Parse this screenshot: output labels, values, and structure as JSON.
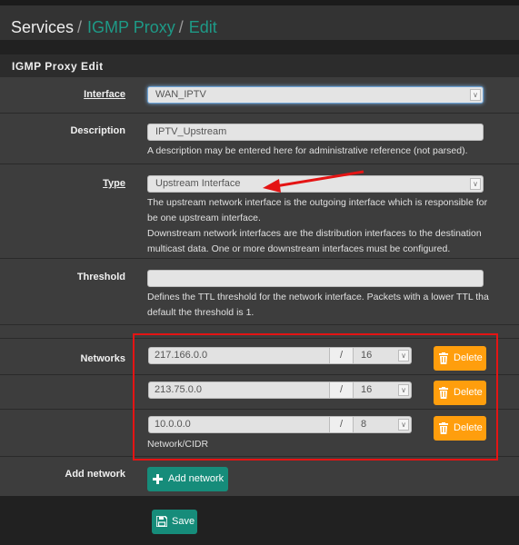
{
  "breadcrumb": {
    "root": "Services",
    "items": [
      "IGMP Proxy",
      "Edit"
    ],
    "separator": "/"
  },
  "panel": {
    "title": "IGMP Proxy Edit"
  },
  "form": {
    "interface": {
      "label": "Interface",
      "value": "WAN_IPTV"
    },
    "description": {
      "label": "Description",
      "value": "IPTV_Upstream",
      "help": "A description may be entered here for administrative reference (not parsed)."
    },
    "type": {
      "label": "Type",
      "value": "Upstream Interface",
      "help": [
        "The upstream network interface is the outgoing interface which is responsible for",
        "be one upstream interface.",
        "Downstream network interfaces are the distribution interfaces to the destination",
        "multicast data. One or more downstream interfaces must be configured."
      ]
    },
    "threshold": {
      "label": "Threshold",
      "value": "",
      "help": [
        "Defines the TTL threshold for the network interface. Packets with a lower TTL tha",
        "default the threshold is 1."
      ]
    },
    "networks": {
      "label": "Networks",
      "slash": "/",
      "help": "Network/CIDR",
      "delete_label": "Delete",
      "rows": [
        {
          "network": "217.166.0.0",
          "cidr": "16"
        },
        {
          "network": "213.75.0.0",
          "cidr": "16"
        },
        {
          "network": "10.0.0.0",
          "cidr": "8"
        }
      ]
    },
    "add_network": {
      "label": "Add network",
      "button": "Add network"
    }
  },
  "save_button": "Save",
  "colors": {
    "accent": "#168c7a",
    "delete": "#ff9e0d",
    "highlight": "#e41414",
    "link": "#1e9a87"
  }
}
